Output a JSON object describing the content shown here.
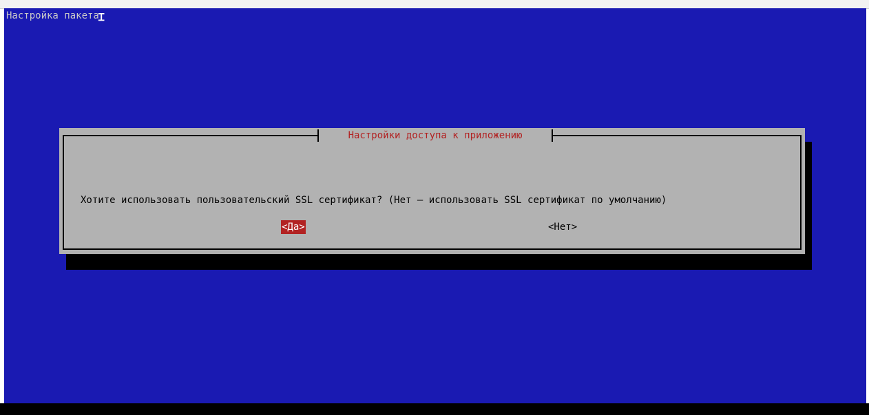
{
  "terminal": {
    "title": "Настройка пакета",
    "background_color": "#1a1ab2"
  },
  "dialog": {
    "title": "Настройки доступа к приложению",
    "question": "Хотите использовать пользовательский SSL сертификат? (Нет – использовать SSL сертификат по умолчанию)",
    "buttons": {
      "yes": "<Да>",
      "no": "<Нет>"
    },
    "selected_button": "yes",
    "accent_color": "#b22222",
    "body_color": "#b2b2b2"
  }
}
